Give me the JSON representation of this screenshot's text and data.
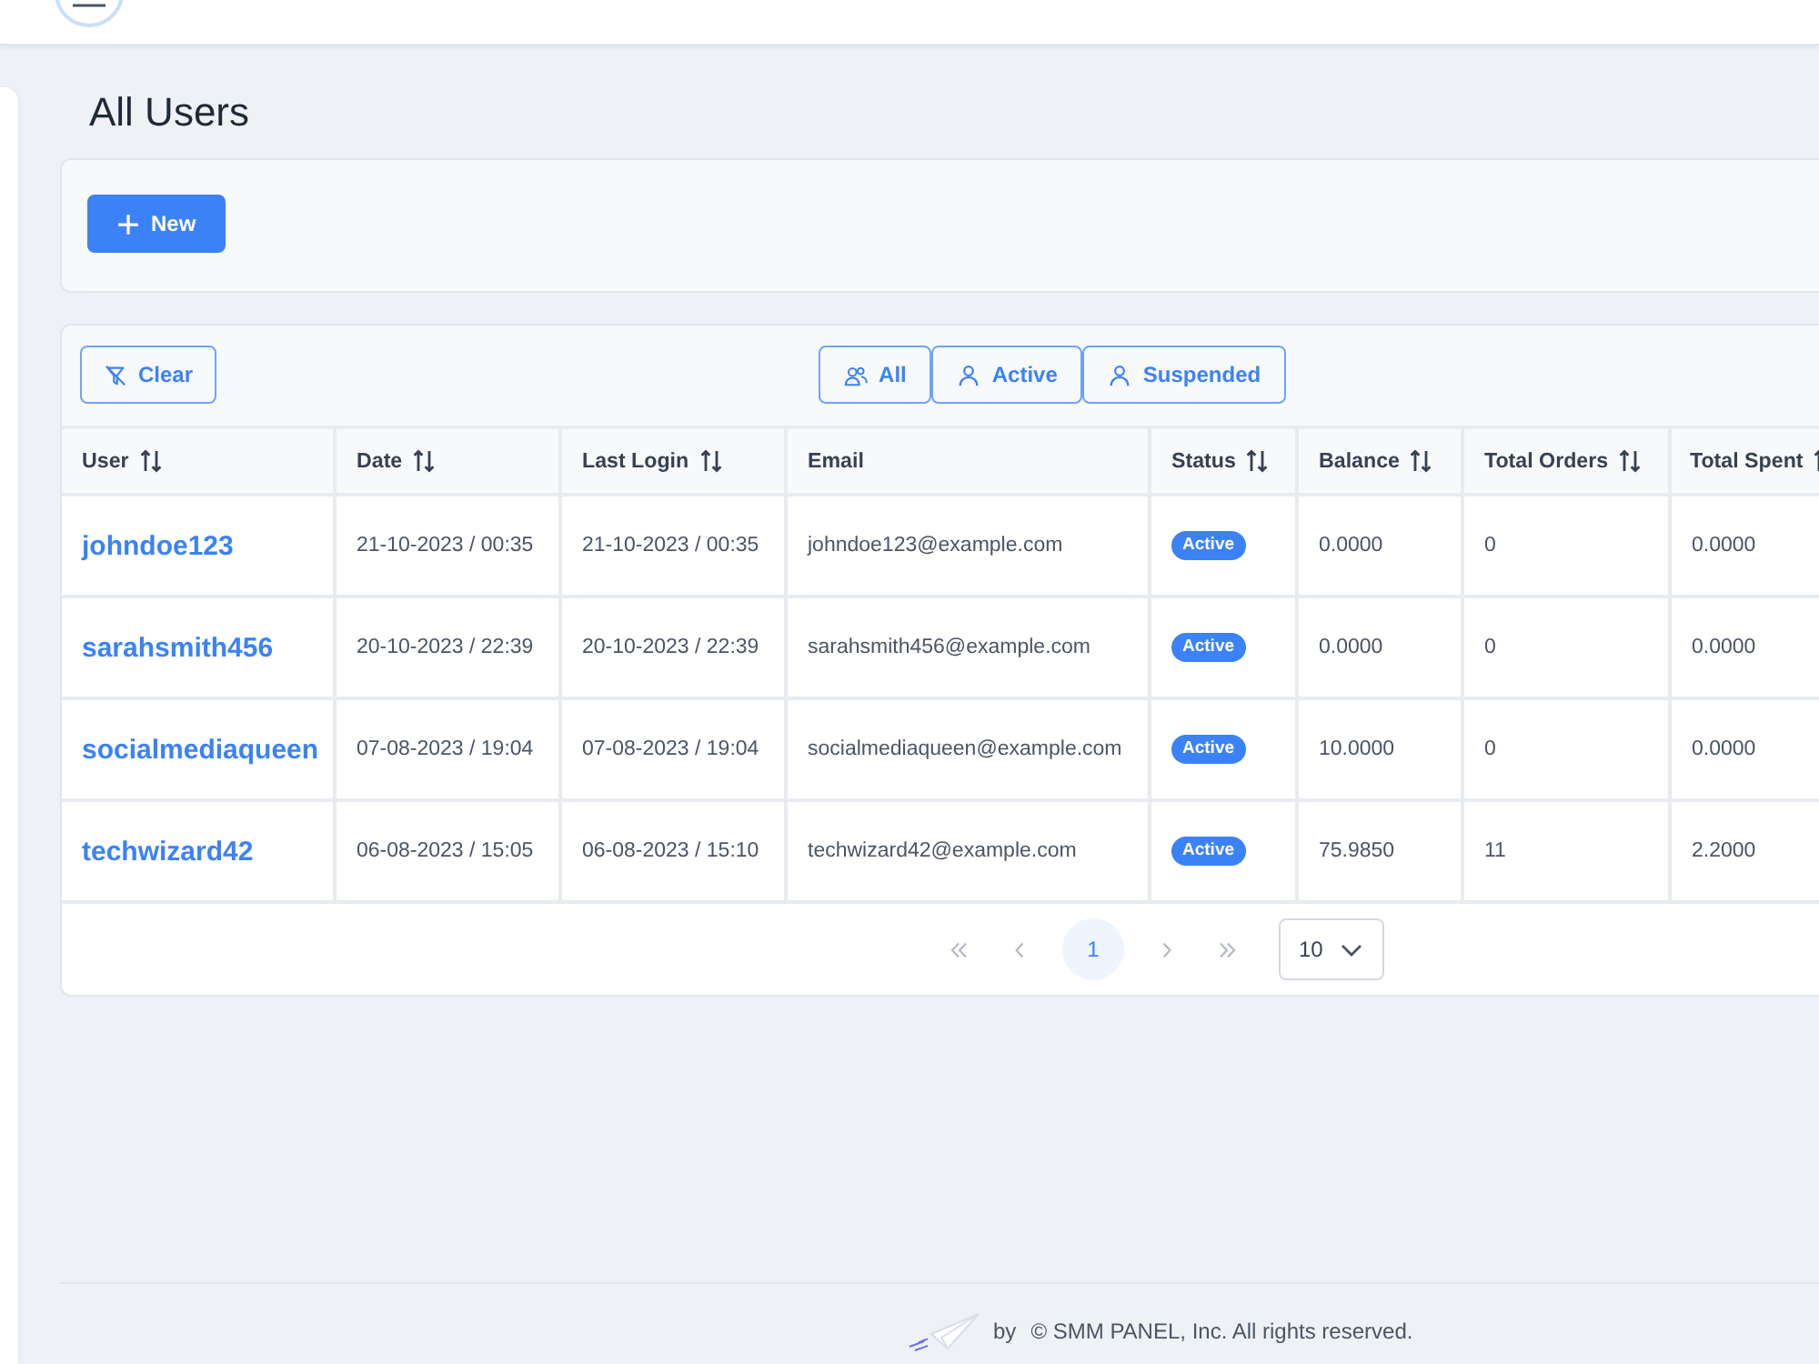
{
  "page": {
    "title": "All Users"
  },
  "toolbar": {
    "new_button": {
      "label": "New"
    }
  },
  "filters": {
    "clear_button": {
      "label": "Clear"
    },
    "status_filters": [
      {
        "label": "All",
        "kind": "group",
        "selected": false
      },
      {
        "label": "Active",
        "kind": "person",
        "selected": false
      },
      {
        "label": "Suspended",
        "kind": "person",
        "selected": false
      }
    ]
  },
  "table": {
    "columns": [
      {
        "label": "User",
        "sortable": true
      },
      {
        "label": "Date",
        "sortable": true
      },
      {
        "label": "Last Login",
        "sortable": true
      },
      {
        "label": "Email",
        "sortable": false
      },
      {
        "label": "Status",
        "sortable": true
      },
      {
        "label": "Balance",
        "sortable": true
      },
      {
        "label": "Total Orders",
        "sortable": true
      },
      {
        "label": "Total Spent",
        "sortable": true
      }
    ],
    "rows": [
      {
        "user": "johndoe123",
        "date": "21-10-2023 / 00:35",
        "last_login": "21-10-2023 / 00:35",
        "email": "johndoe123@example.com",
        "status": "Active",
        "balance": "0.0000",
        "total_orders": "0",
        "total_spent": "0.0000"
      },
      {
        "user": "sarahsmith456",
        "date": "20-10-2023 / 22:39",
        "last_login": "20-10-2023 / 22:39",
        "email": "sarahsmith456@example.com",
        "status": "Active",
        "balance": "0.0000",
        "total_orders": "0",
        "total_spent": "0.0000"
      },
      {
        "user": "socialmediaqueen",
        "date": "07-08-2023 / 19:04",
        "last_login": "07-08-2023 / 19:04",
        "email": "socialmediaqueen@example.com",
        "status": "Active",
        "balance": "10.0000",
        "total_orders": "0",
        "total_spent": "0.0000"
      },
      {
        "user": "techwizard42",
        "date": "06-08-2023 / 15:05",
        "last_login": "06-08-2023 / 15:10",
        "email": "techwizard42@example.com",
        "status": "Active",
        "balance": "75.9850",
        "total_orders": "11",
        "total_spent": "2.2000"
      }
    ]
  },
  "pagination": {
    "first_button": {
      "disabled": true
    },
    "prev_button": {
      "disabled": true
    },
    "pages": [
      {
        "label": "1",
        "selected": true
      }
    ],
    "next_button": {
      "disabled": true
    },
    "last_button": {
      "disabled": true
    },
    "page_size": "10"
  },
  "footer": {
    "prefix": "by",
    "copyright": "© SMM PANEL, Inc. All rights reserved."
  }
}
